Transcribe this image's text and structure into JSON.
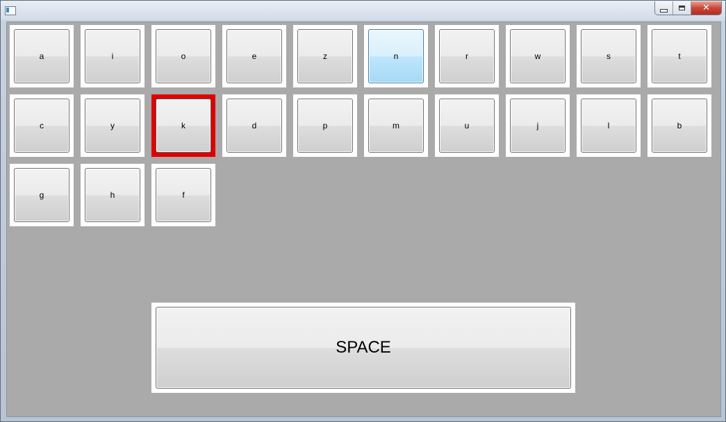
{
  "window": {
    "icon": "app-window-icon",
    "buttons": {
      "minimize_icon": "minimize-icon",
      "maximize_icon": "maximize-icon",
      "close_icon": "close-icon",
      "close_glyph": "✕"
    }
  },
  "keyboard": {
    "rows": [
      [
        "a",
        "i",
        "o",
        "e",
        "z",
        "n",
        "r",
        "w",
        "s",
        "t"
      ],
      [
        "c",
        "y",
        "k",
        "d",
        "p",
        "m",
        "u",
        "j",
        "l",
        "b"
      ],
      [
        "g",
        "h",
        "f"
      ]
    ],
    "hovered_key": "n",
    "focused_key": "k",
    "space_label": "SPACE"
  },
  "colors": {
    "client_background": "#aaaaaa",
    "focus_border": "#e00000",
    "hover_fill": "#bee6fd"
  }
}
